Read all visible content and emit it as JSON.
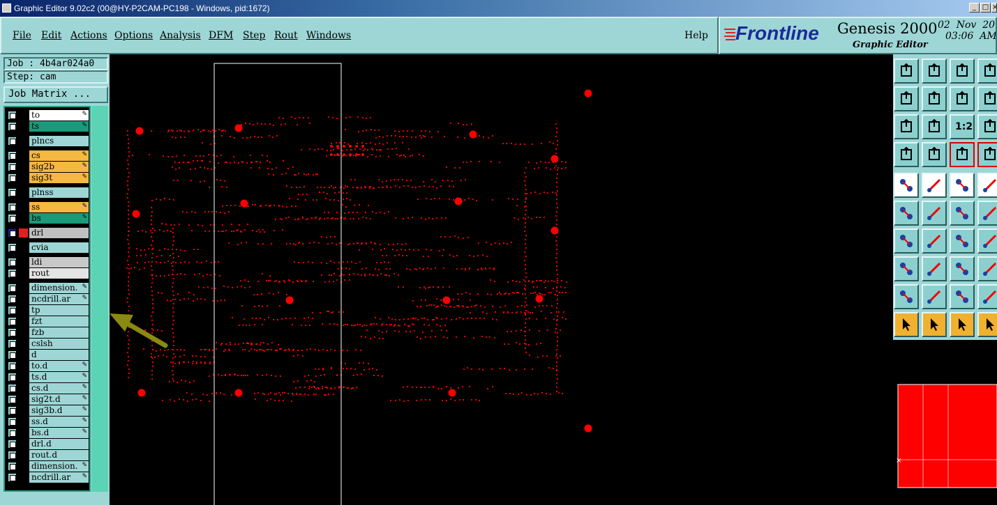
{
  "window": {
    "title": "Graphic Editor 9.02c2 (00@HY-P2CAM-PC198 - Windows, pid:1672)",
    "minimize": "_",
    "maximize": "□",
    "close": "×"
  },
  "menu": {
    "items": [
      "File",
      "Edit",
      "Actions",
      "Options",
      "Analysis",
      "DFM",
      "Step",
      "Rout",
      "Windows"
    ],
    "help": "Help"
  },
  "brand": {
    "logo": "Frontline",
    "product": "Genesis 2000",
    "subtitle": "Graphic Editor",
    "date": "02  Nov  201",
    "time": "03:06  AM"
  },
  "job": {
    "job_label": "Job : 4b4ar024a0",
    "step_label": "Step: cam",
    "matrix_button": "Job Matrix ..."
  },
  "layers": [
    {
      "name": "to",
      "color": "#ffffff",
      "edit": true
    },
    {
      "name": "ts",
      "color": "#1a9a7a",
      "edit": true
    },
    {
      "name": "plncs",
      "color": "#9ed6d6",
      "edit": false
    },
    {
      "name": "cs",
      "color": "#f5b840",
      "edit": true
    },
    {
      "name": "sig2b",
      "color": "#f5b840",
      "edit": true
    },
    {
      "name": "sig3t",
      "color": "#f5b840",
      "edit": true
    },
    {
      "name": "plnss",
      "color": "#9ed6d6",
      "edit": false
    },
    {
      "name": "ss",
      "color": "#f5b840",
      "edit": true
    },
    {
      "name": "bs",
      "color": "#1a9a7a",
      "edit": true
    },
    {
      "name": "drl",
      "color": "#c0c0c0",
      "edit": false,
      "active": true,
      "marker": "#e02020"
    },
    {
      "name": "cvia",
      "color": "#9ed6d6",
      "edit": false
    },
    {
      "name": "ldi",
      "color": "#c8c8c8",
      "edit": false
    },
    {
      "name": "rout",
      "color": "#e4e4e4",
      "edit": false
    },
    {
      "name": "dimension.",
      "color": "#9ed6d6",
      "edit": true
    },
    {
      "name": "ncdrill.ar",
      "color": "#9ed6d6",
      "edit": true
    },
    {
      "name": "tp",
      "color": "#9ed6d6",
      "edit": false
    },
    {
      "name": "fzt",
      "color": "#9ed6d6",
      "edit": false
    },
    {
      "name": "fzb",
      "color": "#9ed6d6",
      "edit": false
    },
    {
      "name": "cslsh",
      "color": "#9ed6d6",
      "edit": false
    },
    {
      "name": "d",
      "color": "#9ed6d6",
      "edit": false
    },
    {
      "name": "to.d",
      "color": "#9ed6d6",
      "edit": true
    },
    {
      "name": "ts.d",
      "color": "#9ed6d6",
      "edit": true
    },
    {
      "name": "cs.d",
      "color": "#9ed6d6",
      "edit": true
    },
    {
      "name": "sig2t.d",
      "color": "#9ed6d6",
      "edit": true
    },
    {
      "name": "sig3b.d",
      "color": "#9ed6d6",
      "edit": true
    },
    {
      "name": "ss.d",
      "color": "#9ed6d6",
      "edit": true
    },
    {
      "name": "bs.d",
      "color": "#9ed6d6",
      "edit": true
    },
    {
      "name": "drl.d",
      "color": "#9ed6d6",
      "edit": false
    },
    {
      "name": "rout.d",
      "color": "#9ed6d6",
      "edit": false
    },
    {
      "name": "dimension.",
      "color": "#9ed6d6",
      "edit": true
    },
    {
      "name": "ncdrill.ar",
      "color": "#9ed6d6",
      "edit": true
    }
  ],
  "colors": {
    "panel": "#9ed6d6",
    "drill": "#ff0000",
    "arrow": "#8a8a10",
    "canvas": "#000000"
  },
  "toolbar": {
    "buttons": [
      "send-up-icon",
      "send-down-icon",
      "home-icon",
      "window-icon",
      "pan-left-icon",
      "pan-right-icon",
      "undo-icon",
      "snap-icon",
      "zoom-fit-icon",
      "zoom-center-icon",
      "scale-1-2-icon",
      "help-icon",
      "measure-settings-icon",
      "probe-icon",
      "net-view-icon",
      "net-view-2-icon",
      "pad-select-icon",
      "line-draw-icon",
      "ruler-icon",
      "dot-icon",
      "connect-icon",
      "delete-net-icon",
      "line-end-icon",
      "line-end-2-icon",
      "angle-icon",
      "slash-icon",
      "arc-icon",
      "bracket-icon",
      "pad-link-icon",
      "bar-icon",
      "move-icon",
      "multi-pad-icon",
      "triangle-icon",
      "triangle-line-icon",
      "arch-icon",
      "arch-2-icon",
      "pointer-icon",
      "pointer-box-icon",
      "pointer-rect-icon",
      "pointer-step-icon"
    ],
    "scale_label": "1:2"
  }
}
